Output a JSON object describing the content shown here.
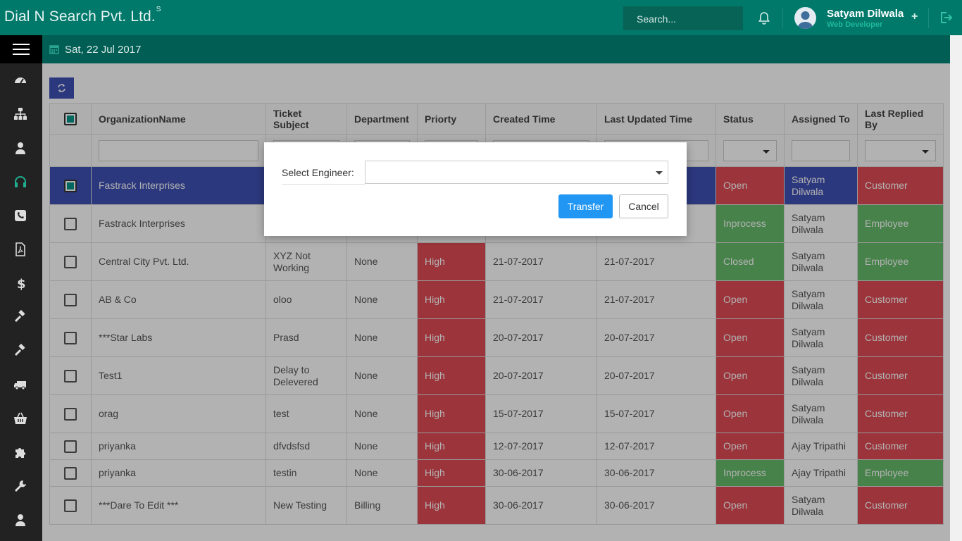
{
  "header": {
    "brand": "Dial N Search Pvt. Ltd.",
    "brand_sup": "S",
    "search_placeholder": "Search...",
    "user_name": "Satyam Dilwala",
    "user_role": "Web Developer",
    "plus": "+"
  },
  "subheader": {
    "date": "Sat, 22 Jul 2017"
  },
  "sidebar": {
    "icons": [
      "dashboard-icon",
      "sitemap-icon",
      "user-icon",
      "headset-icon",
      "phone-icon",
      "pdf-icon",
      "dollar-icon",
      "gavel-icon",
      "gavel-icon",
      "truck-icon",
      "basket-icon",
      "puzzle-icon",
      "wrench-icon",
      "user-icon"
    ],
    "active_index": 3
  },
  "table": {
    "columns": [
      "OrganizationName",
      "Ticket Subject",
      "Department",
      "Priorty",
      "Created Time",
      "Last Updated Time",
      "Status",
      "Assigned To",
      "Last Replied By"
    ],
    "rows": [
      {
        "org": "Fastrack Interprises",
        "subject": "",
        "dept": "",
        "priority": "",
        "created": "",
        "updated": "",
        "status": "Open",
        "assigned": "Satyam Dilwala",
        "replied": "Customer",
        "selected": true
      },
      {
        "org": "Fastrack Interprises",
        "subject": "",
        "dept": "",
        "priority": "",
        "created": "",
        "updated": "",
        "status": "Inprocess",
        "assigned": "Satyam Dilwala",
        "replied": "Employee"
      },
      {
        "org": "Central City Pvt. Ltd.",
        "subject": "XYZ Not Working",
        "dept": "None",
        "priority": "High",
        "created": "21-07-2017",
        "updated": "21-07-2017",
        "status": "Closed",
        "assigned": "Satyam Dilwala",
        "replied": "Employee"
      },
      {
        "org": "AB & Co",
        "subject": "oloo",
        "dept": "None",
        "priority": "High",
        "created": "21-07-2017",
        "updated": "21-07-2017",
        "status": "Open",
        "assigned": "Satyam Dilwala",
        "replied": "Customer"
      },
      {
        "org": "***Star Labs",
        "subject": "Prasd",
        "dept": "None",
        "priority": "High",
        "created": "20-07-2017",
        "updated": "20-07-2017",
        "status": "Open",
        "assigned": "Satyam Dilwala",
        "replied": "Customer"
      },
      {
        "org": "Test1",
        "subject": "Delay to Delevered",
        "dept": "None",
        "priority": "High",
        "created": "20-07-2017",
        "updated": "20-07-2017",
        "status": "Open",
        "assigned": "Satyam Dilwala",
        "replied": "Customer"
      },
      {
        "org": "orag",
        "subject": "test",
        "dept": "None",
        "priority": "High",
        "created": "15-07-2017",
        "updated": "15-07-2017",
        "status": "Open",
        "assigned": "Satyam Dilwala",
        "replied": "Customer"
      },
      {
        "org": "priyanka",
        "subject": "dfvdsfsd",
        "dept": "None",
        "priority": "High",
        "created": "12-07-2017",
        "updated": "12-07-2017",
        "status": "Open",
        "assigned": "Ajay Tripathi",
        "replied": "Customer"
      },
      {
        "org": "priyanka",
        "subject": "testin",
        "dept": "None",
        "priority": "High",
        "created": "30-06-2017",
        "updated": "30-06-2017",
        "status": "Inprocess",
        "assigned": "Ajay Tripathi",
        "replied": "Employee"
      },
      {
        "org": "***Dare To Edit ***",
        "subject": "New Testing",
        "dept": "Billing",
        "priority": "High",
        "created": "30-06-2017",
        "updated": "30-06-2017",
        "status": "Open",
        "assigned": "Satyam Dilwala",
        "replied": "Customer"
      }
    ]
  },
  "modal": {
    "label": "Select Engineer:",
    "selected": "",
    "transfer": "Transfer",
    "cancel": "Cancel"
  },
  "colors": {
    "header": "#00796b",
    "subheader": "#005e54",
    "red": "#e04b55",
    "green": "#66bb6a",
    "blue": "#3f51b5",
    "primary": "#2196f3"
  }
}
